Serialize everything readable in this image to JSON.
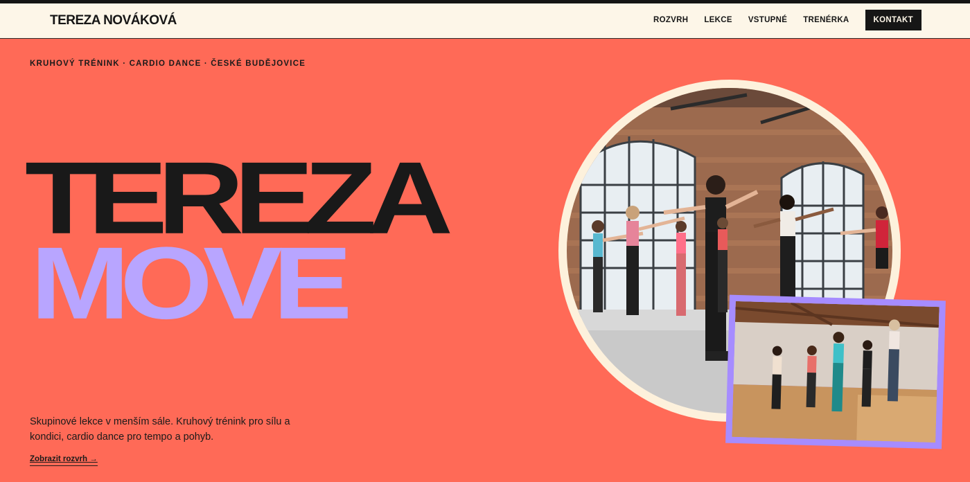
{
  "header": {
    "brand": "TEREZA NOVÁKOVÁ",
    "nav": [
      "ROZVRH",
      "LEKCE",
      "VSTUPNÉ",
      "TRENÉRKA"
    ],
    "cta": "KONTAKT"
  },
  "hero": {
    "kicker": "KRUHOVÝ TRÉNINK · CARDIO DANCE · ČESKÉ BUDĚJOVICE",
    "title_line1": "TEREZA",
    "title_line2": "MOVE",
    "description": "Skupinové lekce v menším sále. Kruhový trénink pro sílu a kondici, cardio dance pro tempo a pohyb.",
    "link": "Zobrazit rozvrh →"
  },
  "colors": {
    "background": "#ff6a57",
    "header_bg": "#fdf6e8",
    "ink": "#161616",
    "accent_lavender": "#b8a5ff",
    "frame_cream": "#fdf1dc",
    "frame_purple": "#a68cff"
  }
}
